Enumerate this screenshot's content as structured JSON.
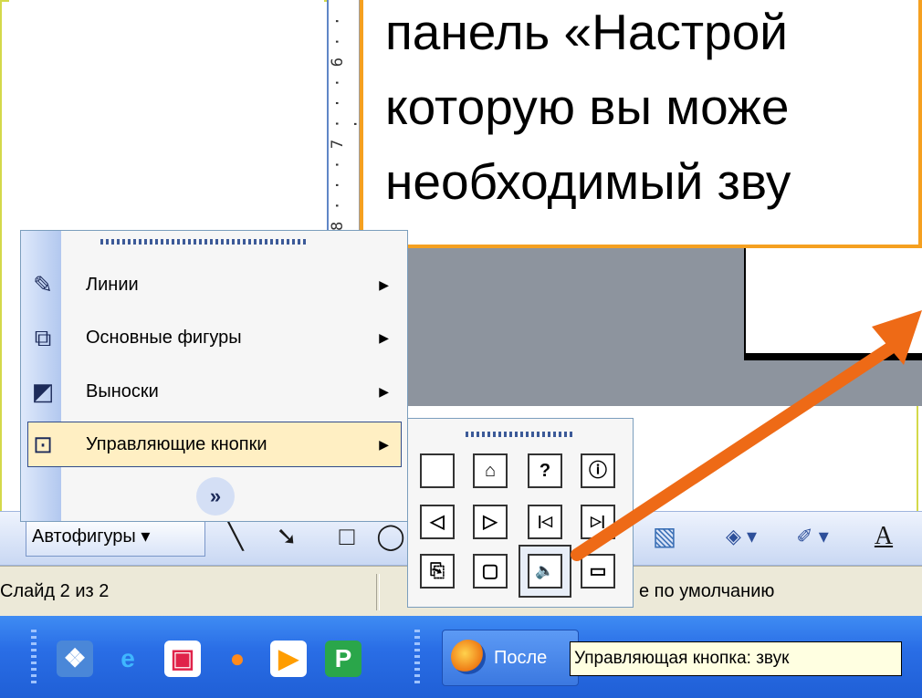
{
  "callout": {
    "line1": "панель «Настрой",
    "line2": "которую вы може",
    "line3": "необходимый зву"
  },
  "ruler": {
    "text": "8 · · · 7 · · · 6 · · ·"
  },
  "autoshapes_menu": {
    "items": [
      {
        "label": "Линии",
        "icon": "lines-icon",
        "glyph": "✎"
      },
      {
        "label": "Основные фигуры",
        "icon": "basic-shapes-icon",
        "glyph": "⧉"
      },
      {
        "label": "Выноски",
        "icon": "callouts-icon",
        "glyph": "◩"
      },
      {
        "label": "Управляющие кнопки",
        "icon": "action-buttons-icon",
        "glyph": "⊡"
      }
    ],
    "submenu_arrow": "▶",
    "more_glyph": "»"
  },
  "action_buttons": {
    "rows": [
      [
        "",
        "⌂",
        "?",
        "ⓘ"
      ],
      [
        "◁",
        "▷",
        "|◁",
        "▷|"
      ],
      [
        "⎘",
        "▢",
        "🔈",
        "▭"
      ]
    ]
  },
  "toolbar": {
    "autoshapes_label": "Автофигуры ▾",
    "icons": [
      "line-tool-icon",
      "arrow-tool-icon",
      "rectangle-tool-icon",
      "oval-tool-icon",
      "picture-icon",
      "fill-color-icon",
      "line-color-icon",
      "font-color-icon"
    ],
    "line_glyph": "╲",
    "arrow_glyph": "➘",
    "rect_glyph": "□",
    "oval_glyph": "◯",
    "picture_glyph": "▧",
    "fill_glyph": "◈ ▾",
    "linecolor_glyph": "✐ ▾",
    "fontcolor_glyph": "A"
  },
  "status_bar": {
    "slide_info": "Слайд 2 из 2",
    "design": "е по умолчанию"
  },
  "taskbar": {
    "quick_launch": [
      {
        "icon": "desktop-icon",
        "glyph": "❖",
        "color": "#ffffff",
        "bg": "#4a87d8"
      },
      {
        "icon": "internet-explorer-icon",
        "glyph": "e",
        "color": "#3fb7ff",
        "bg": "transparent"
      },
      {
        "icon": "save-icon",
        "glyph": "▣",
        "color": "#e0234a",
        "bg": "#ffffff"
      },
      {
        "icon": "firefox-icon",
        "glyph": "●",
        "color": "#ff8a1c",
        "bg": "transparent"
      },
      {
        "icon": "media-player-icon",
        "glyph": "▶",
        "color": "#ff9d00",
        "bg": "#ffffff"
      },
      {
        "icon": "project-icon",
        "glyph": "P",
        "color": "#ffffff",
        "bg": "#2aa64a"
      }
    ],
    "task_label": "После"
  },
  "tooltip": {
    "text": "Управляющая кнопка: звук"
  },
  "colors": {
    "arrow": "#ee6a16",
    "callout_border": "#f5a020",
    "taskbar": "#2a6ee6"
  }
}
